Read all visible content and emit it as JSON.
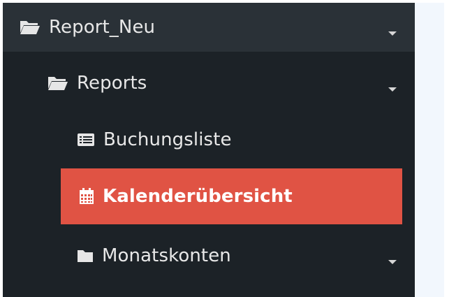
{
  "sidebar": {
    "items": [
      {
        "label": "Report_Neu",
        "icon": "folder-open-icon",
        "expandable": true
      },
      {
        "label": "Reports",
        "icon": "folder-open-icon",
        "expandable": true
      },
      {
        "label": "Buchungsliste",
        "icon": "list-alt-icon",
        "expandable": false
      },
      {
        "label": "Kalenderübersicht",
        "icon": "calendar-icon",
        "expandable": false,
        "active": true
      },
      {
        "label": "Monatskonten",
        "icon": "folder-icon",
        "expandable": true
      }
    ]
  },
  "colors": {
    "sidebar_bg": "#1c2227",
    "root_item_bg": "#2a3137",
    "active_bg": "#e05344",
    "text": "#e8e8e8",
    "main_bg": "#f2f7fd"
  }
}
